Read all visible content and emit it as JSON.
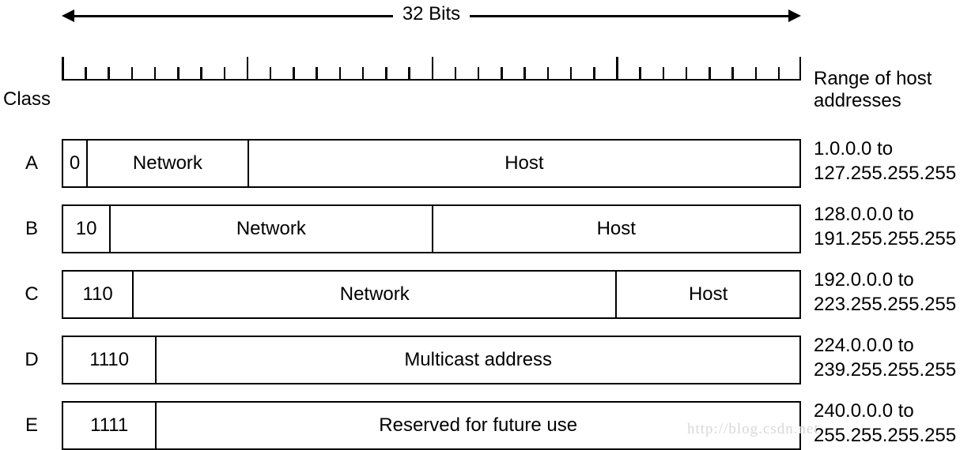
{
  "diagram": {
    "width_arrow_label": "32 Bits",
    "class_heading": "Class",
    "range_heading_line1": "Range of host",
    "range_heading_line2": "addresses",
    "ruler": {
      "total_bits": 32,
      "major_tick_every": 8
    },
    "watermark": "http://blog.csdn.net",
    "colors": {
      "stroke": "#000000",
      "background": "#ffffff",
      "watermark": "#d8d8d8"
    },
    "rows": [
      {
        "letter": "A",
        "fields": [
          {
            "label": "0",
            "bits": 1
          },
          {
            "label": "Network",
            "bits": 7
          },
          {
            "label": "Host",
            "bits": 24
          }
        ],
        "range_line1": "1.0.0.0 to",
        "range_line2": "127.255.255.255"
      },
      {
        "letter": "B",
        "fields": [
          {
            "label": "10",
            "bits": 2
          },
          {
            "label": "Network",
            "bits": 14
          },
          {
            "label": "Host",
            "bits": 16
          }
        ],
        "range_line1": "128.0.0.0 to",
        "range_line2": "191.255.255.255"
      },
      {
        "letter": "C",
        "fields": [
          {
            "label": "110",
            "bits": 3
          },
          {
            "label": "Network",
            "bits": 21
          },
          {
            "label": "Host",
            "bits": 8
          }
        ],
        "range_line1": "192.0.0.0 to",
        "range_line2": "223.255.255.255"
      },
      {
        "letter": "D",
        "fields": [
          {
            "label": "1110",
            "bits": 4
          },
          {
            "label": "Multicast address",
            "bits": 28
          }
        ],
        "range_line1": "224.0.0.0 to",
        "range_line2": "239.255.255.255"
      },
      {
        "letter": "E",
        "fields": [
          {
            "label": "1111",
            "bits": 4
          },
          {
            "label": "Reserved for future use",
            "bits": 28
          }
        ],
        "range_line1": "240.0.0.0 to",
        "range_line2": "255.255.255.255"
      }
    ]
  }
}
